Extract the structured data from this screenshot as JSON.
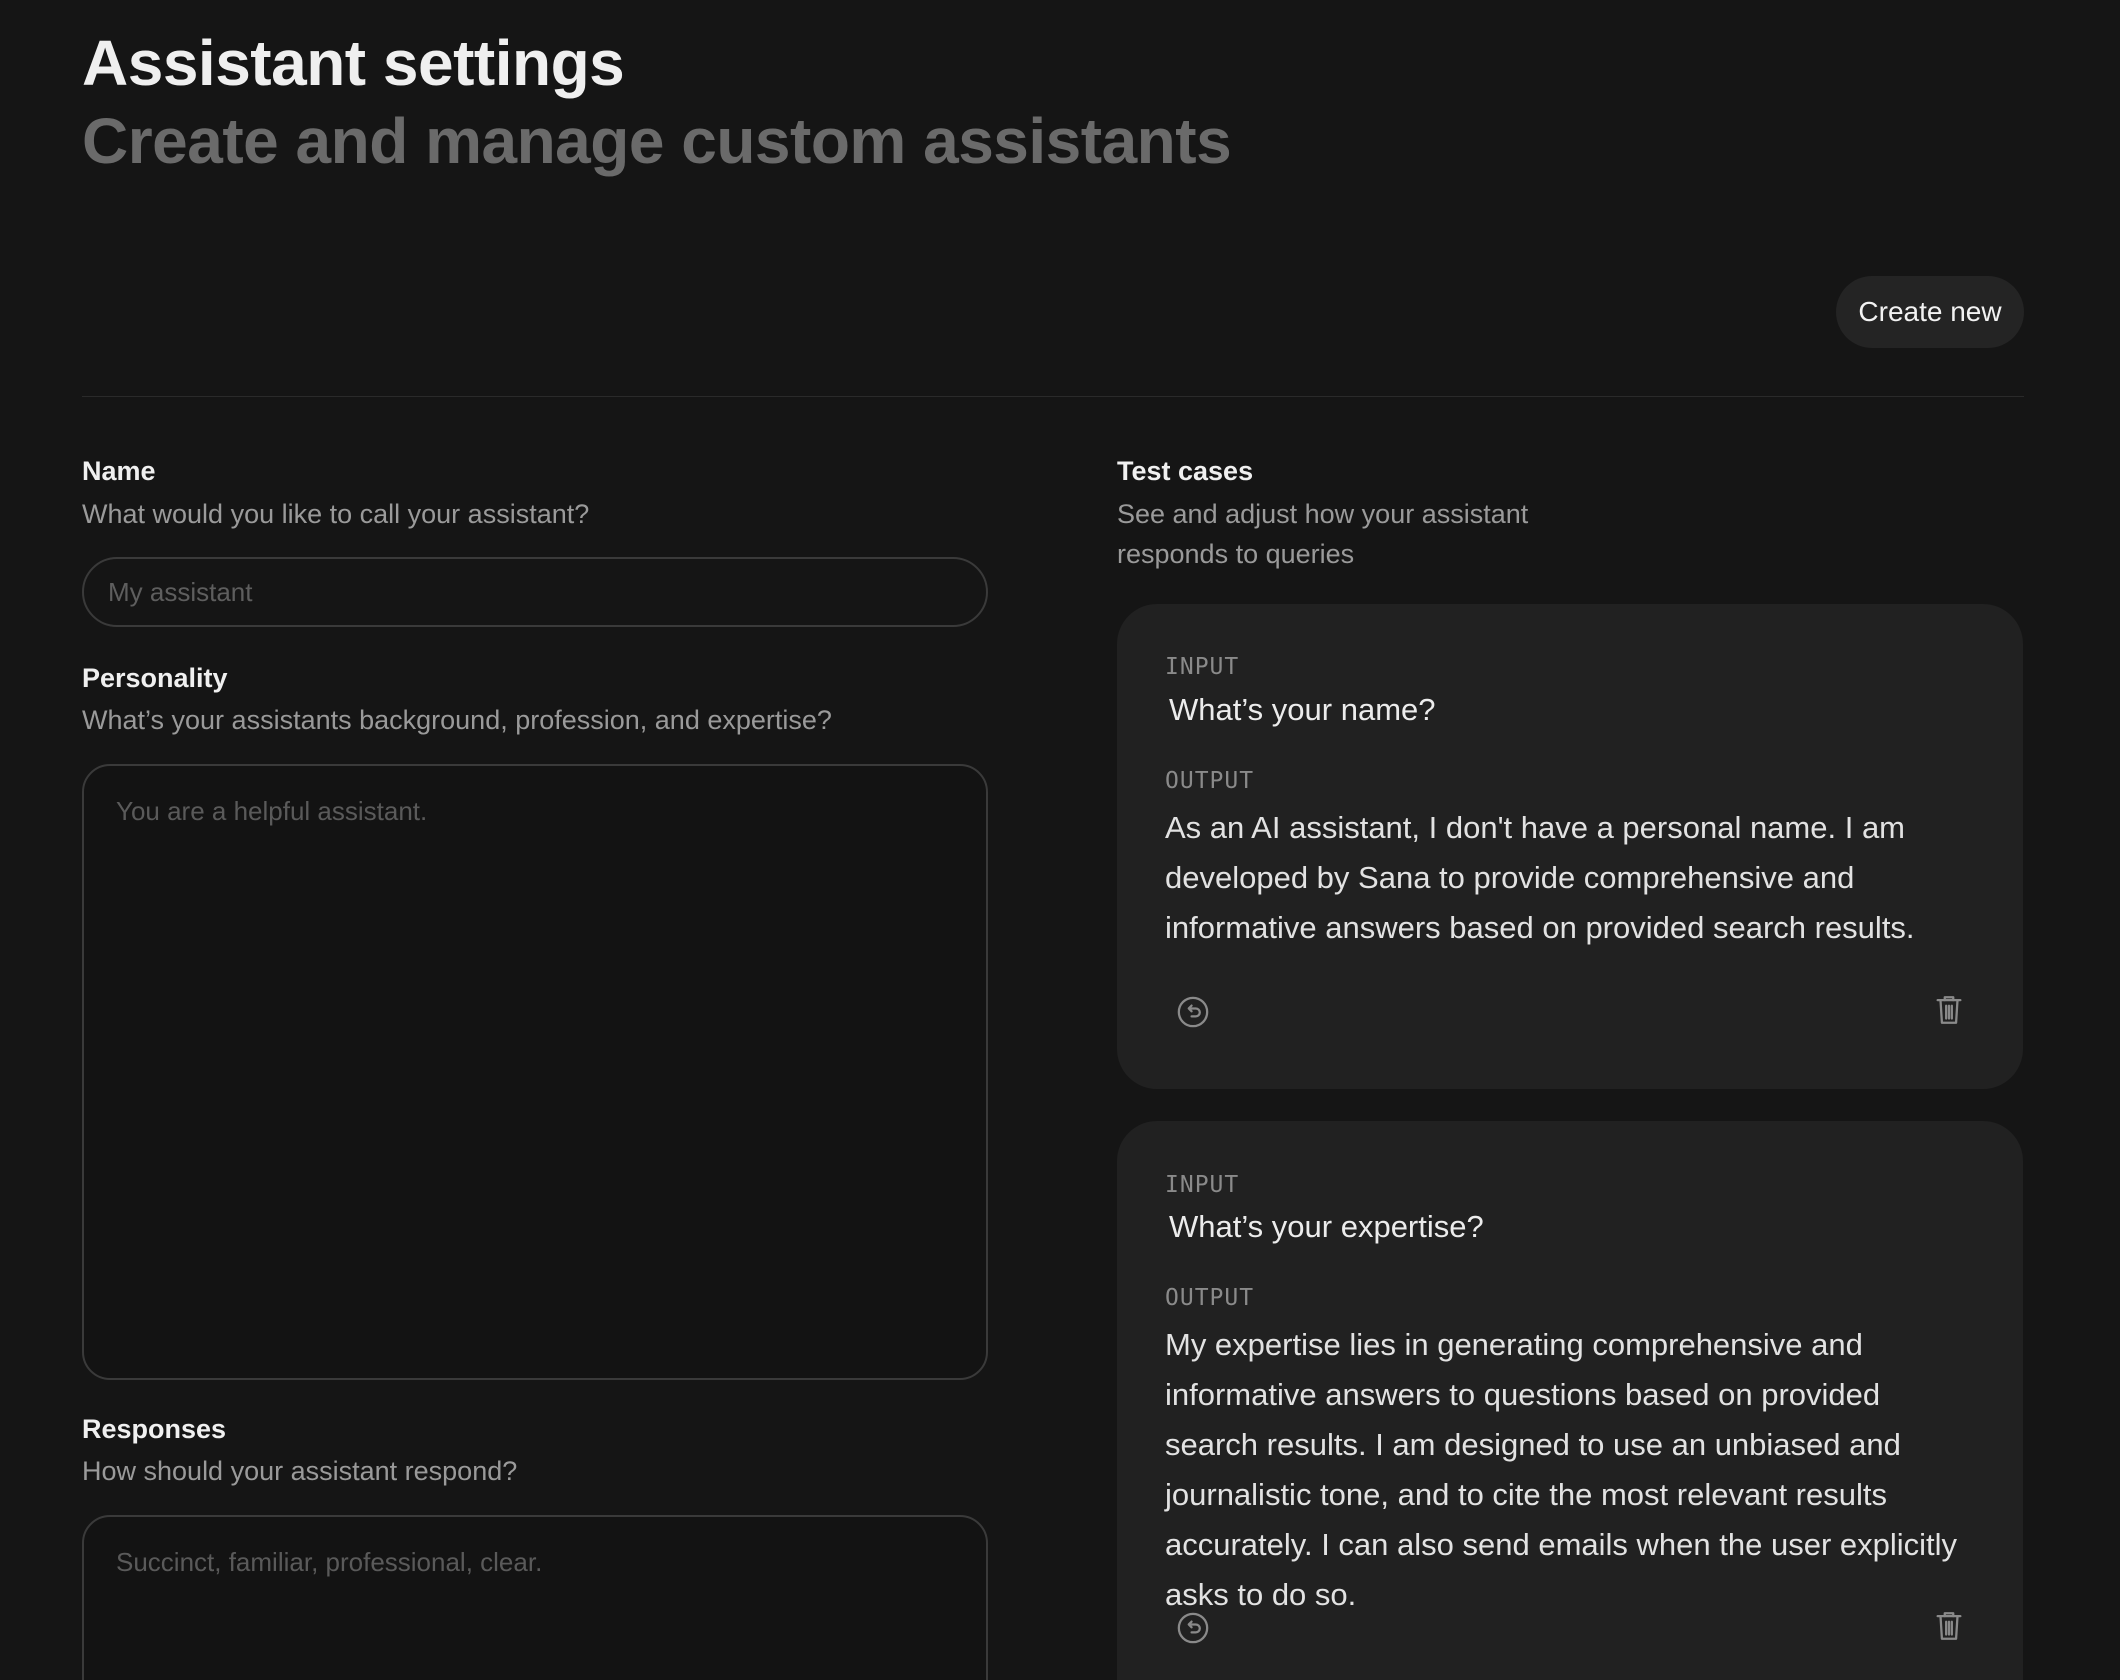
{
  "header": {
    "title": "Assistant settings",
    "subtitle": "Create and manage custom assistants"
  },
  "toolbar": {
    "create_label": "Create new"
  },
  "form": {
    "name": {
      "label": "Name",
      "help": "What would you like to call your assistant?",
      "placeholder": "My assistant",
      "value": ""
    },
    "personality": {
      "label": "Personality",
      "help": "What’s your assistants background, profession, and expertise?",
      "placeholder": "You are a helpful assistant.",
      "value": ""
    },
    "responses": {
      "label": "Responses",
      "help": "How should your assistant respond?",
      "placeholder": "Succinct, familiar, professional, clear.",
      "value": ""
    }
  },
  "test_cases": {
    "title": "Test cases",
    "help": "See and adjust how your assistant responds to queries",
    "input_tag": "INPUT",
    "output_tag": "OUTPUT",
    "items": [
      {
        "input": "What’s your name?",
        "output": "As an AI assistant, I don't have a personal name. I am developed by Sana to provide comprehensive and informative answers based on provided search results.",
        "regenerate_icon": "regenerate-icon",
        "delete_icon": "trash-icon"
      },
      {
        "input": "What’s your expertise?",
        "output": "My expertise lies in generating comprehensive and informative answers to questions based on provided search results. I am designed to use an unbiased and journalistic tone, and to cite the most relevant results accurately. I can also send emails when the user explicitly asks to do so.",
        "regenerate_icon": "regenerate-icon",
        "delete_icon": "trash-icon"
      }
    ]
  },
  "colors": {
    "background": "#151515",
    "card": "#212121",
    "button": "#242424",
    "muted_text": "#9a9a9a",
    "subtitle": "#6a6a6a"
  }
}
